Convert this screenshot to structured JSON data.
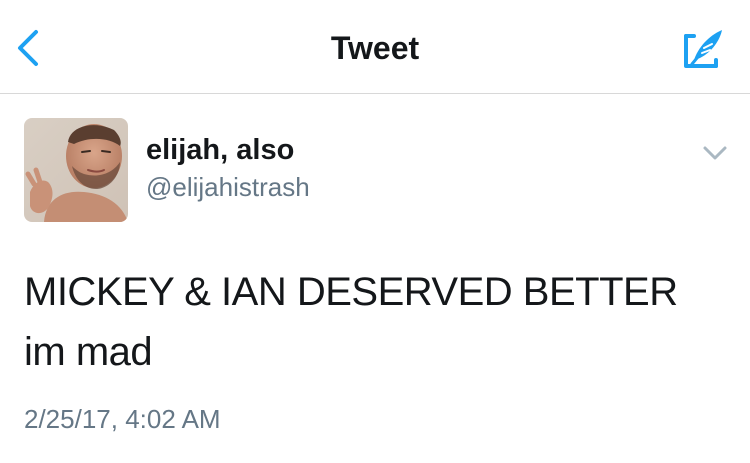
{
  "nav": {
    "title": "Tweet",
    "back_icon": "chevron-left-icon",
    "compose_icon": "compose-quill-icon",
    "accent_color": "#1da1f2"
  },
  "tweet": {
    "display_name": "elijah, also",
    "handle": "@elijahistrash",
    "text": "MICKEY & IAN DESERVED BETTER im mad",
    "timestamp": "2/25/17, 4:02 AM",
    "caret_icon": "chevron-down-icon",
    "avatar_icon": "profile-photo"
  },
  "colors": {
    "text_primary": "#14171a",
    "text_secondary": "#657786",
    "divider": "#d8d8d8"
  }
}
